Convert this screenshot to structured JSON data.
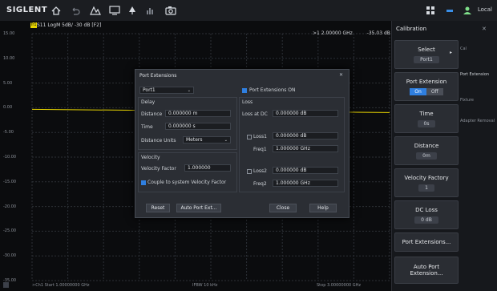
{
  "toolbar": {
    "brand": "SIGLENT",
    "local_label": "Local"
  },
  "trace": {
    "tag": "Tr1",
    "header": "S11 LogM 5dB/ -30 dB [F2]"
  },
  "marker_readout": {
    "left": ">1  2.00000 GHz",
    "right": "-35.03 dB"
  },
  "y_axis_labels": [
    "15.00",
    "10.00",
    "5.00",
    "0.00",
    "-5.00",
    "-10.00",
    "-15.00",
    "-20.00",
    "-25.00",
    "-30.00",
    "-35.00"
  ],
  "footer": {
    "left": ">Ch1  Start 1.00000000 GHz",
    "mid": "IFBW 10 kHz",
    "right": "Stop 3.00000000 GHz"
  },
  "panel": {
    "title": "Calibration",
    "select": {
      "label": "Select",
      "value": "Port1"
    },
    "port_extension": {
      "label": "Port Extension",
      "on": "On",
      "off": "Off"
    },
    "time": {
      "label": "Time",
      "value": "0s"
    },
    "distance": {
      "label": "Distance",
      "value": "0m"
    },
    "velocity_factory": {
      "label": "Velocity Factory",
      "value": "1"
    },
    "dc_loss": {
      "label": "DC Loss",
      "value": "0 dB"
    },
    "port_extensions_btn": "Port Extensions...",
    "auto_btn": "Auto Port Extension...",
    "side_links": [
      "Cal",
      "Port Extension",
      "Fixture",
      "Adapter Removal"
    ]
  },
  "dialog": {
    "title": "Port Extensions",
    "port_select": "Port1",
    "enable_label": "Port Extensions ON",
    "delay_title": "Delay",
    "distance_label": "Distance",
    "distance_value": "0.000000 m",
    "time_label": "Time",
    "time_value": "0.000000 s",
    "distance_units_label": "Distance Units",
    "distance_units_value": "Meters",
    "velocity_title": "Velocity",
    "velocity_factor_label": "Velocity Factor",
    "velocity_factor_value": "1.000000",
    "couple_label": "Couple to system Velocity Factor",
    "loss_title": "Loss",
    "loss_dc_label": "Loss at DC",
    "loss_dc_value": "0.000000 dB",
    "loss1_label": "Loss1",
    "loss1_value": "0.000000 dB",
    "freq1_label": "Freq1",
    "freq1_value": "1.000000 GHz",
    "loss2_label": "Loss2",
    "loss2_value": "0.000000 dB",
    "freq2_label": "Freq2",
    "freq2_value": "1.000000 GHz",
    "reset_label": "Reset",
    "auto_label": "Auto Port Ext...",
    "close_label": "Close",
    "help_label": "Help"
  }
}
